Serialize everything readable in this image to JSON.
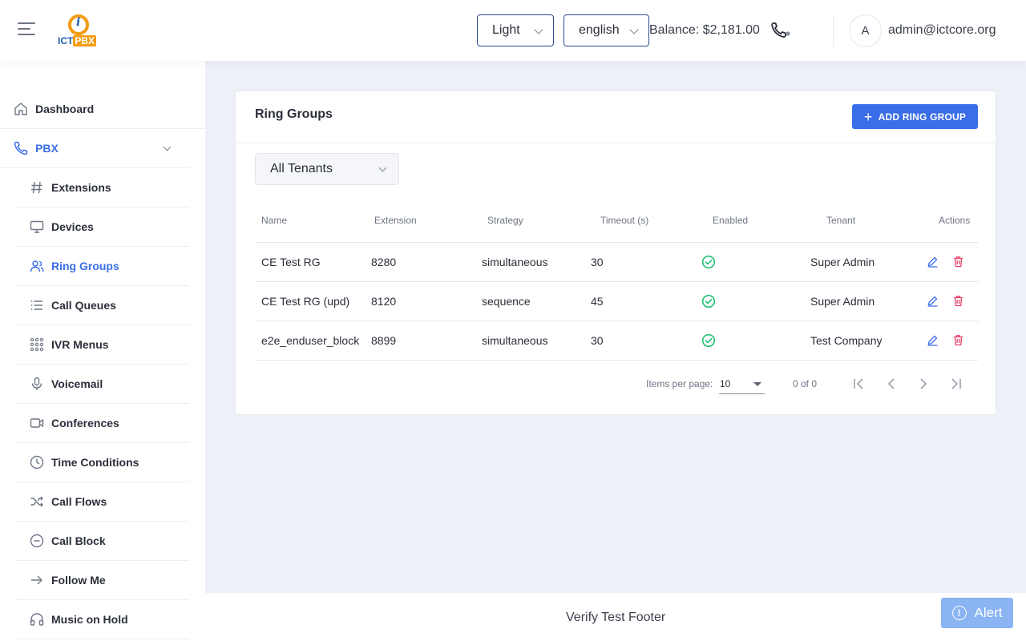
{
  "header": {
    "theme_select": "Light",
    "language_select": "english",
    "balance": "Balance: $2,181.00",
    "avatar_initial": "A",
    "user_email": "admin@ictcore.org",
    "logo_text_a": "ICT",
    "logo_text_b": "PBX"
  },
  "sidebar": {
    "dashboard": "Dashboard",
    "pbx": "PBX",
    "items": [
      {
        "label": "Extensions",
        "icon": "hash-icon"
      },
      {
        "label": "Devices",
        "icon": "monitor-icon"
      },
      {
        "label": "Ring Groups",
        "icon": "users-icon"
      },
      {
        "label": "Call Queues",
        "icon": "list-icon"
      },
      {
        "label": "IVR Menus",
        "icon": "grid-icon"
      },
      {
        "label": "Voicemail",
        "icon": "mic-icon"
      },
      {
        "label": "Conferences",
        "icon": "video-icon"
      },
      {
        "label": "Time Conditions",
        "icon": "clock-icon"
      },
      {
        "label": "Call Flows",
        "icon": "shuffle-icon"
      },
      {
        "label": "Call Block",
        "icon": "minus-circle-icon"
      },
      {
        "label": "Follow Me",
        "icon": "arrow-right-icon"
      },
      {
        "label": "Music on Hold",
        "icon": "headphones-icon"
      }
    ]
  },
  "main": {
    "title": "Ring Groups",
    "add_button": "ADD RING GROUP",
    "tenant_filter": "All Tenants",
    "columns": [
      "Name",
      "Extension",
      "Strategy",
      "Timeout (s)",
      "Enabled",
      "Tenant",
      "Actions"
    ],
    "rows": [
      {
        "name": "CE Test RG",
        "extension": "8280",
        "strategy": "simultaneous",
        "timeout": "30",
        "enabled": true,
        "tenant": "Super Admin"
      },
      {
        "name": "CE Test RG (upd)",
        "extension": "8120",
        "strategy": "sequence",
        "timeout": "45",
        "enabled": true,
        "tenant": "Super Admin"
      },
      {
        "name": "e2e_enduser_block",
        "extension": "8899",
        "strategy": "simultaneous",
        "timeout": "30",
        "enabled": true,
        "tenant": "Test Company"
      }
    ],
    "paginator": {
      "items_per_page_label": "Items per page:",
      "items_per_page": "10",
      "range": "0 of 0"
    }
  },
  "footer": {
    "text": "Verify Test Footer",
    "alert_button": "Alert"
  },
  "colors": {
    "accent": "#3a6ee8",
    "success": "#1fbf75",
    "danger": "#e8456b"
  }
}
